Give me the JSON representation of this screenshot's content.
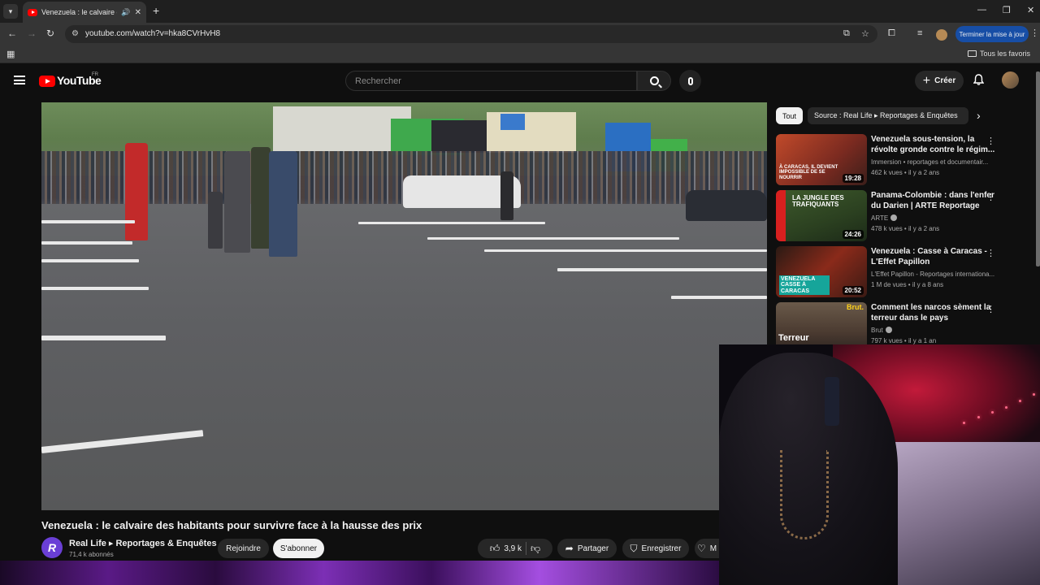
{
  "browser": {
    "tab_title": "Venezuela : le calvaire des ha",
    "url": "youtube.com/watch?v=hka8CVrHvH8",
    "update_button": "Terminer la mise à jour",
    "bookmarks_all": "Tous les favoris"
  },
  "youtube": {
    "logo": "YouTube",
    "country": "FR",
    "search_placeholder": "Rechercher",
    "create_label": "Créer"
  },
  "video": {
    "title": "Venezuela : le calvaire des habitants pour survivre face à la hausse des prix",
    "channel_initial": "R",
    "channel_name": "Real Life ▸ Reportages & Enquêtes",
    "subscribers": "71,4 k abonnés",
    "join_label": "Rejoindre",
    "subscribe_label": "S'abonner",
    "likes": "3,9 k",
    "share_label": "Partager",
    "save_label": "Enregistrer",
    "more_label": "M"
  },
  "sidebar": {
    "chips": [
      "Tout",
      "Source : Real Life ▸ Reportages & Enquêtes"
    ],
    "recommendations": [
      {
        "title": "Venezuela sous-tension, la révolte gronde contre le régim...",
        "channel": "Immersion • reportages et documentair...",
        "meta": "462 k vues • il y a 2 ans",
        "duration": "19:28",
        "thumb_text": "À CARACAS, IL DEVIENT IMPOSSIBLE DE SE NOURRIR"
      },
      {
        "title": "Panama-Colombie : dans l'enfer du Darien | ARTE Reportage",
        "channel": "ARTE",
        "meta": "478 k vues • il y a 2 ans",
        "duration": "24:26",
        "thumb_text": "LA JUNGLE DES TRAFIQUANTS"
      },
      {
        "title": "Venezuela : Casse à Caracas - L'Effet Papillon",
        "channel": "L'Effet Papillon - Reportages internationa...",
        "meta": "1 M de vues • il y a 8 ans",
        "duration": "20:52",
        "thumb_text": "VENEZUELA CASSE À CARACAS"
      },
      {
        "title": "Comment les narcos sèment la terreur dans le pays",
        "channel": "Brut",
        "meta": "797 k vues • il y a 1 an",
        "duration": "",
        "thumb_text": "Terreur",
        "thumb_badge": "Brut."
      }
    ]
  },
  "colors": {
    "accent_red": "#ff0000",
    "background": "#0f0f0f",
    "update_blue": "#174ea6"
  }
}
